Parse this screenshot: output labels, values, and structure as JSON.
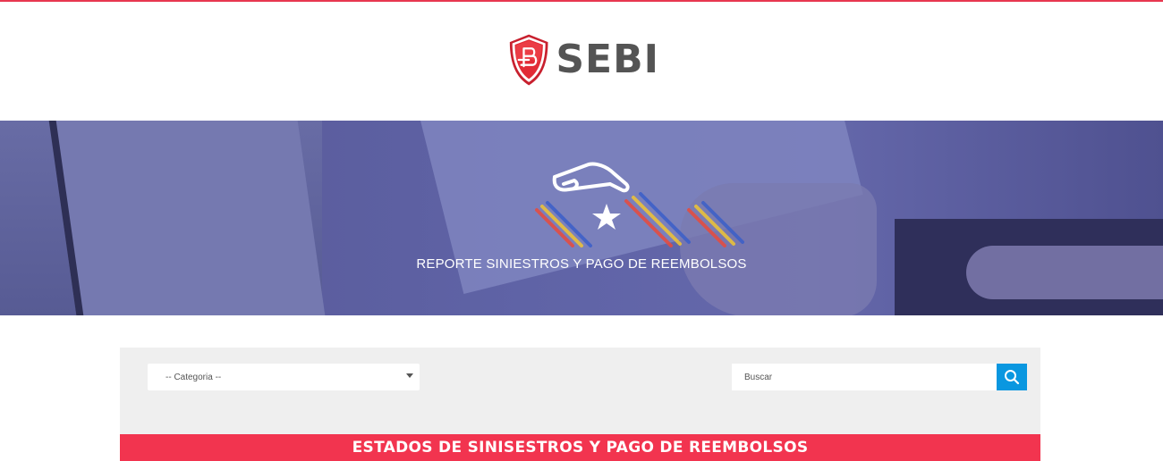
{
  "brand": {
    "name": "SEBI",
    "logo_icon": "shield-sb-icon",
    "accent_color": "#e8374f"
  },
  "hero": {
    "title": "REPORTE SINIESTROS Y PAGO DE REEMBOLSOS",
    "icon": "hand-star-icon"
  },
  "filters": {
    "category_selected": "-- Categoria --",
    "search_placeholder": "Buscar",
    "search_icon": "search-icon"
  },
  "section": {
    "title": "ESTADOS DE SINISESTROS Y PAGO DE REEMBOLSOS"
  },
  "colors": {
    "primary_red": "#f2344f",
    "search_blue": "#0a97e0",
    "panel_gray": "#efefef"
  }
}
